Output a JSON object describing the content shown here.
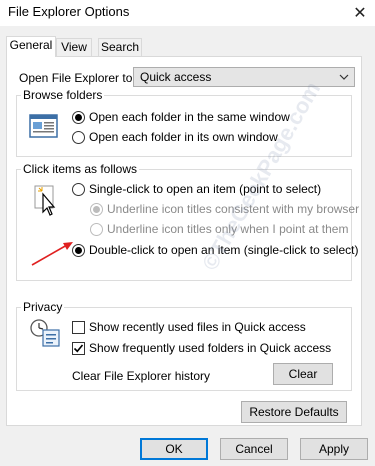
{
  "window": {
    "title": "File Explorer Options"
  },
  "tabs": [
    {
      "label": "General",
      "active": true
    },
    {
      "label": "View",
      "active": false
    },
    {
      "label": "Search",
      "active": false
    }
  ],
  "open_explorer": {
    "label": "Open File Explorer to:",
    "value": "Quick access"
  },
  "browse_folders": {
    "title": "Browse folders",
    "options": [
      {
        "label": "Open each folder in the same window",
        "checked": true
      },
      {
        "label": "Open each folder in its own window",
        "checked": false
      }
    ]
  },
  "click_items": {
    "title": "Click items as follows",
    "single_click": "Single-click to open an item (point to select)",
    "underline_browser": "Underline icon titles consistent with my browser",
    "underline_point": "Underline icon titles only when I point at them",
    "double_click": "Double-click to open an item (single-click to select)"
  },
  "privacy": {
    "title": "Privacy",
    "show_recent_files": "Show recently used files in Quick access",
    "show_frequent_folders": "Show frequently used folders in Quick access",
    "clear_history_label": "Clear File Explorer history",
    "clear_button": "Clear"
  },
  "restore_defaults": "Restore Defaults",
  "footer": {
    "ok": "OK",
    "cancel": "Cancel",
    "apply": "Apply"
  },
  "watermark": "©TheGeekPage.com",
  "colors": {
    "accent": "#0078d7",
    "annotation_arrow": "#e02020"
  }
}
